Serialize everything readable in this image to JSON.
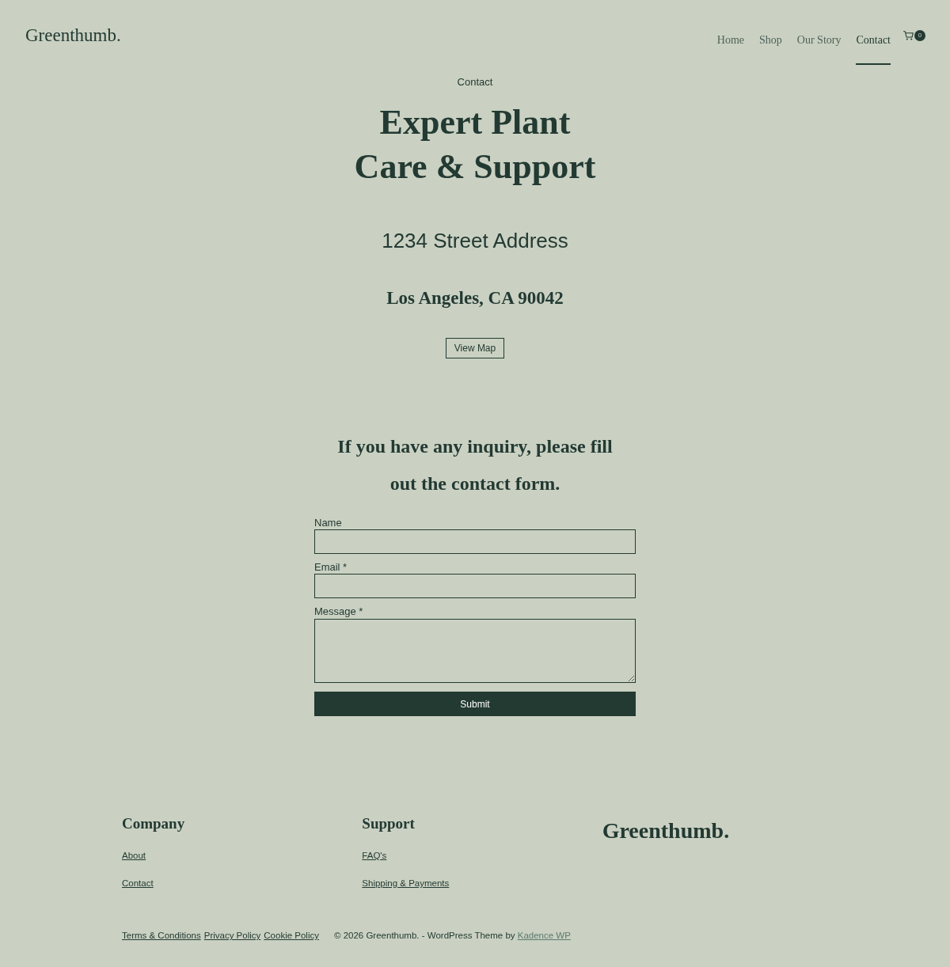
{
  "header": {
    "logo": "Greenthumb.",
    "nav": [
      {
        "label": "Home",
        "selected": false
      },
      {
        "label": "Shop",
        "selected": false
      },
      {
        "label": "Our Story",
        "selected": false
      },
      {
        "label": "Contact",
        "selected": true
      }
    ],
    "cart_count": "0"
  },
  "hero": {
    "breadcrumb": "Contact",
    "title": "Expert Plant Care & Support",
    "street": "1234 Street Address",
    "city": "Los Angeles, CA 90042",
    "map_button": "View Map"
  },
  "contact_form": {
    "intro": "If you have any inquiry, please fill out the contact form.",
    "fields": [
      {
        "label": "Name",
        "kind": "input"
      },
      {
        "label": "Email *",
        "kind": "input"
      },
      {
        "label": "Message *",
        "kind": "textarea"
      }
    ],
    "submit": "Submit"
  },
  "footer": {
    "columns": [
      {
        "heading": "Company",
        "links": [
          "About",
          "Contact"
        ]
      },
      {
        "heading": "Support",
        "links": [
          "FAQ's",
          "Shipping & Payments"
        ]
      }
    ],
    "logo": "Greenthumb.",
    "legal_links": [
      "Terms & Conditions",
      "Privacy Policy",
      "Cookie Policy"
    ],
    "copyright": "© 2026 Greenthumb. - WordPress Theme by",
    "credit_link": "Kadence WP"
  }
}
